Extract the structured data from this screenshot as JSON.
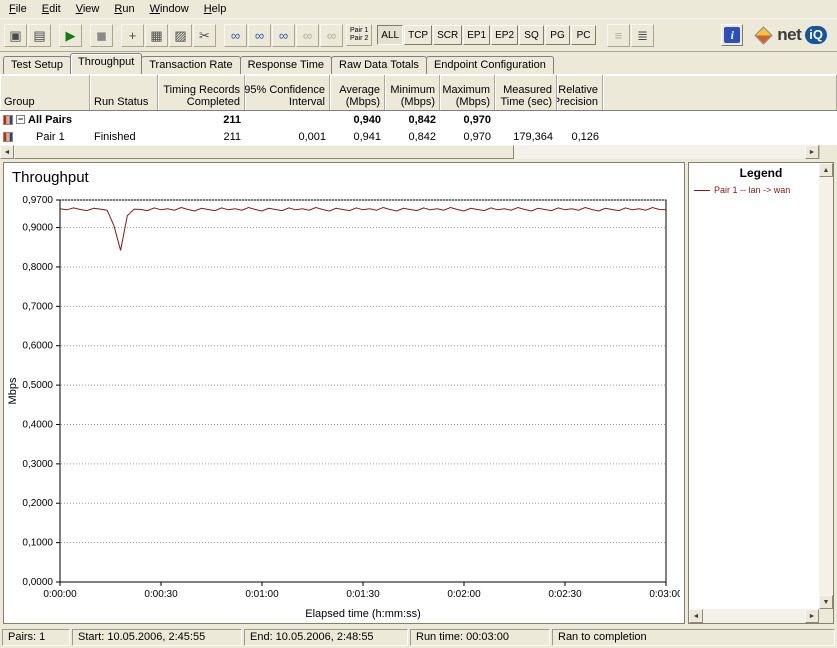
{
  "menu": {
    "items": [
      "File",
      "Edit",
      "View",
      "Run",
      "Window",
      "Help"
    ]
  },
  "toolbar": {
    "icon_groups": [
      [
        {
          "name": "new-test-icon",
          "glyph": "▣"
        },
        {
          "name": "print-icon",
          "glyph": "▤"
        }
      ],
      [
        {
          "name": "run-test-icon",
          "glyph": "▶",
          "color": "#127a12"
        }
      ],
      [
        {
          "name": "stop-icon",
          "glyph": "◼",
          "color": "#8a8a8a"
        }
      ],
      [
        {
          "name": "add-pair-icon",
          "glyph": "+"
        },
        {
          "name": "copy-icon",
          "glyph": "▦"
        },
        {
          "name": "paste-icon",
          "glyph": "▨"
        },
        {
          "name": "cut-icon",
          "glyph": "✂"
        }
      ],
      [
        {
          "name": "pair-link-icon",
          "glyph": "∞",
          "color": "#2a5fb0"
        },
        {
          "name": "pair-swap-icon",
          "glyph": "∞",
          "color": "#2a5fb0"
        },
        {
          "name": "pair-group-icon",
          "glyph": "∞",
          "color": "#2a5fb0"
        },
        {
          "name": "pair-link-disabled-icon",
          "glyph": "∞",
          "disabled": true
        },
        {
          "name": "pair-group-disabled-icon",
          "glyph": "∞",
          "disabled": true
        }
      ]
    ],
    "pair_button": {
      "top": "Pair 1",
      "bottom": "Pair 2"
    },
    "filter_buttons": [
      {
        "label": "ALL",
        "pressed": true
      },
      {
        "label": "TCP"
      },
      {
        "label": "SCR"
      },
      {
        "label": "EP1"
      },
      {
        "label": "EP2"
      },
      {
        "label": "SQ"
      },
      {
        "label": "PG"
      },
      {
        "label": "PC"
      }
    ],
    "view_icons": [
      {
        "name": "list-view-icon",
        "glyph": "≡",
        "disabled": true
      },
      {
        "name": "details-view-icon",
        "glyph": "≣"
      }
    ],
    "info_button": {
      "glyph": "i"
    },
    "logo": {
      "net": "net",
      "iq": "iQ"
    }
  },
  "tabs": {
    "items": [
      "Test Setup",
      "Throughput",
      "Transaction Rate",
      "Response Time",
      "Raw Data Totals",
      "Endpoint Configuration"
    ],
    "active": 1
  },
  "table": {
    "headers": [
      {
        "lines": [
          "Group"
        ],
        "align": "left"
      },
      {
        "lines": [
          "Run Status"
        ],
        "align": "left"
      },
      {
        "lines": [
          "Timing Records",
          "Completed"
        ],
        "align": "right"
      },
      {
        "lines": [
          "95% Confidence",
          "Interval"
        ],
        "align": "right"
      },
      {
        "lines": [
          "Average",
          "(Mbps)"
        ],
        "align": "right"
      },
      {
        "lines": [
          "Minimum",
          "(Mbps)"
        ],
        "align": "right"
      },
      {
        "lines": [
          "Maximum",
          "(Mbps)"
        ],
        "align": "right"
      },
      {
        "lines": [
          "Measured",
          "Time (sec)"
        ],
        "align": "right"
      },
      {
        "lines": [
          "Relative",
          "Precision"
        ],
        "align": "right"
      },
      {
        "lines": [],
        "align": "left"
      }
    ],
    "rows": [
      {
        "level": 0,
        "expander": "−",
        "label": "All Pairs",
        "bold": true,
        "cells": [
          "",
          "211",
          "",
          "0,940",
          "0,842",
          "0,970",
          "",
          ""
        ]
      },
      {
        "level": 1,
        "expander": null,
        "label": "Pair 1",
        "bold": false,
        "cells": [
          "Finished",
          "211",
          "0,001",
          "0,941",
          "0,842",
          "0,970",
          "179,364",
          "0,126"
        ]
      }
    ]
  },
  "chart_data": {
    "type": "line",
    "title": "Throughput",
    "xlabel": "Elapsed time (h:mm:ss)",
    "ylabel": "Mbps",
    "xlim": [
      0,
      180
    ],
    "ylim": [
      0,
      0.97
    ],
    "grid": "horizontal-dotted",
    "legend_position": "right-panel",
    "y_ticks": [
      {
        "v": 0.97,
        "label": "0,9700"
      },
      {
        "v": 0.9,
        "label": "0,9000"
      },
      {
        "v": 0.8,
        "label": "0,8000"
      },
      {
        "v": 0.7,
        "label": "0,7000"
      },
      {
        "v": 0.6,
        "label": "0,6000"
      },
      {
        "v": 0.5,
        "label": "0,5000"
      },
      {
        "v": 0.4,
        "label": "0,4000"
      },
      {
        "v": 0.3,
        "label": "0,3000"
      },
      {
        "v": 0.2,
        "label": "0,2000"
      },
      {
        "v": 0.1,
        "label": "0,1000"
      },
      {
        "v": 0.0,
        "label": "0,0000"
      }
    ],
    "x_ticks": [
      {
        "s": 0,
        "label": "0:00:00"
      },
      {
        "s": 30,
        "label": "0:00:30"
      },
      {
        "s": 60,
        "label": "0:01:00"
      },
      {
        "s": 90,
        "label": "0:01:30"
      },
      {
        "s": 120,
        "label": "0:02:00"
      },
      {
        "s": 150,
        "label": "0:02:30"
      },
      {
        "s": 180,
        "label": "0:03:00"
      }
    ],
    "series": [
      {
        "name": "Pair 1 -- lan -> wan",
        "color": "#8b1713",
        "dt": 2,
        "values": [
          0.948,
          0.945,
          0.95,
          0.946,
          0.943,
          0.949,
          0.947,
          0.944,
          0.905,
          0.842,
          0.93,
          0.947,
          0.946,
          0.943,
          0.95,
          0.945,
          0.948,
          0.944,
          0.951,
          0.946,
          0.942,
          0.949,
          0.946,
          0.943,
          0.95,
          0.945,
          0.948,
          0.944,
          0.951,
          0.946,
          0.942,
          0.949,
          0.946,
          0.943,
          0.95,
          0.945,
          0.948,
          0.944,
          0.951,
          0.946,
          0.942,
          0.949,
          0.946,
          0.943,
          0.95,
          0.945,
          0.948,
          0.944,
          0.951,
          0.946,
          0.942,
          0.949,
          0.946,
          0.943,
          0.95,
          0.945,
          0.948,
          0.944,
          0.951,
          0.946,
          0.942,
          0.949,
          0.946,
          0.943,
          0.95,
          0.945,
          0.948,
          0.944,
          0.951,
          0.946,
          0.942,
          0.949,
          0.946,
          0.943,
          0.95,
          0.945,
          0.948,
          0.944,
          0.951,
          0.946,
          0.942,
          0.949,
          0.946,
          0.943,
          0.95,
          0.945,
          0.948,
          0.944,
          0.951,
          0.946,
          0.945
        ]
      }
    ]
  },
  "legend": {
    "title": "Legend",
    "entries": [
      {
        "label": "Pair 1 -- lan -> wan",
        "color": "#8b1713"
      }
    ]
  },
  "statusbar": {
    "segments": [
      "Pairs: 1",
      "Start: 10.05.2006, 2:45:55",
      "End: 10.05.2006, 2:48:55",
      "Run time: 00:03:00",
      "Ran to completion"
    ]
  },
  "scrollbar": {
    "left": "◄",
    "right": "►",
    "up": "▲",
    "down": "▼"
  }
}
